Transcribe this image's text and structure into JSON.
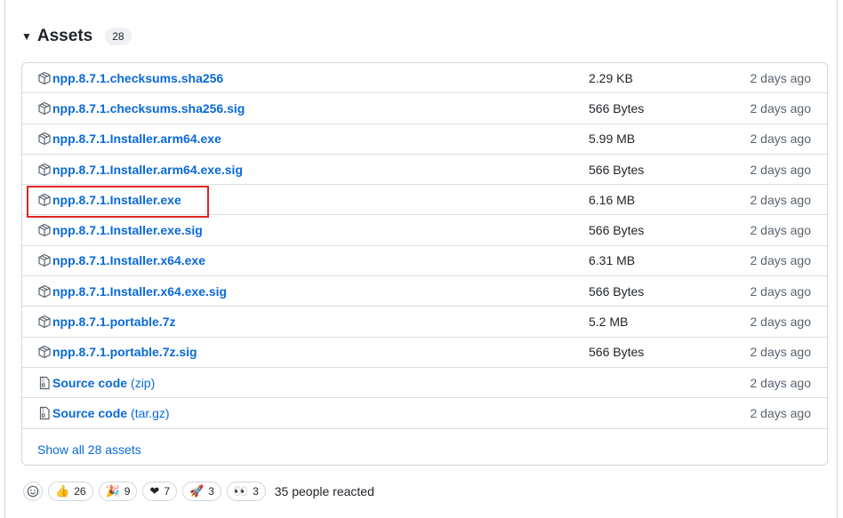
{
  "assets": {
    "title": "Assets",
    "count": "28",
    "rows": [
      {
        "name": "npp.8.7.1.checksums.sha256",
        "size": "2.29 KB",
        "date": "2 days ago",
        "icon": "package-icon"
      },
      {
        "name": "npp.8.7.1.checksums.sha256.sig",
        "size": "566 Bytes",
        "date": "2 days ago",
        "icon": "package-icon"
      },
      {
        "name": "npp.8.7.1.Installer.arm64.exe",
        "size": "5.99 MB",
        "date": "2 days ago",
        "icon": "package-icon"
      },
      {
        "name": "npp.8.7.1.Installer.arm64.exe.sig",
        "size": "566 Bytes",
        "date": "2 days ago",
        "icon": "package-icon"
      },
      {
        "name": "npp.8.7.1.Installer.exe",
        "size": "6.16 MB",
        "date": "2 days ago",
        "icon": "package-icon"
      },
      {
        "name": "npp.8.7.1.Installer.exe.sig",
        "size": "566 Bytes",
        "date": "2 days ago",
        "icon": "package-icon"
      },
      {
        "name": "npp.8.7.1.Installer.x64.exe",
        "size": "6.31 MB",
        "date": "2 days ago",
        "icon": "package-icon"
      },
      {
        "name": "npp.8.7.1.Installer.x64.exe.sig",
        "size": "566 Bytes",
        "date": "2 days ago",
        "icon": "package-icon"
      },
      {
        "name": "npp.8.7.1.portable.7z",
        "size": "5.2 MB",
        "date": "2 days ago",
        "icon": "package-icon"
      },
      {
        "name": "npp.8.7.1.portable.7z.sig",
        "size": "566 Bytes",
        "date": "2 days ago",
        "icon": "package-icon"
      },
      {
        "name": "Source code",
        "suffix": "(zip)",
        "size": "",
        "date": "2 days ago",
        "icon": "file-zip-icon"
      },
      {
        "name": "Source code",
        "suffix": "(tar.gz)",
        "size": "",
        "date": "2 days ago",
        "icon": "file-zip-icon"
      }
    ],
    "show_all": "Show all 28 assets"
  },
  "reactions": {
    "items": [
      {
        "emoji": "👍",
        "count": "26"
      },
      {
        "emoji": "🎉",
        "count": "9"
      },
      {
        "emoji": "❤",
        "count": "7"
      },
      {
        "emoji": "🚀",
        "count": "3"
      },
      {
        "emoji": "👀",
        "count": "3"
      }
    ],
    "summary": "35 people reacted"
  },
  "colors": {
    "link": "#0969da",
    "highlight": "#e02424",
    "border": "#d0d7de"
  }
}
